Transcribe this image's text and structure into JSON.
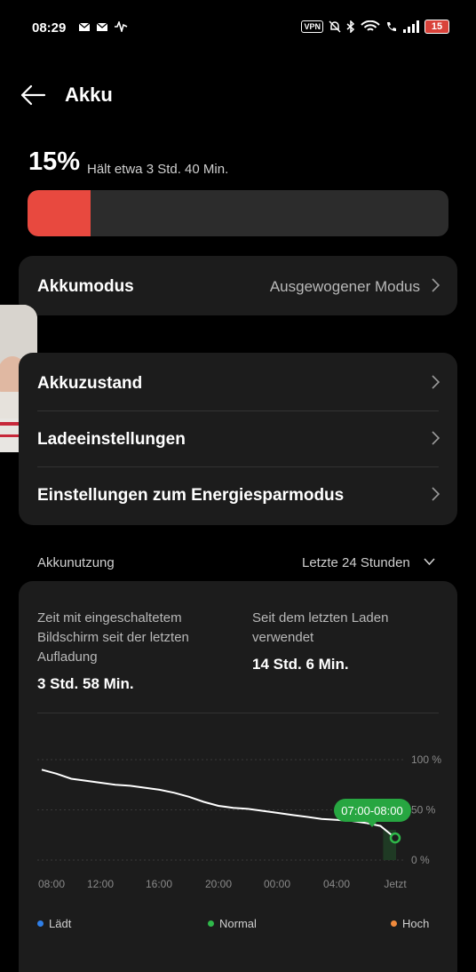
{
  "status_bar": {
    "time": "08:29",
    "vpn": "VPN",
    "battery": "15"
  },
  "header": {
    "title": "Akku"
  },
  "battery": {
    "percent_label": "15%",
    "percent_value": 15,
    "remaining": "Hält etwa 3 Std. 40 Min."
  },
  "mode_row": {
    "label": "Akkumodus",
    "value": "Ausgewogener Modus"
  },
  "settings": [
    {
      "label": "Akkuzustand"
    },
    {
      "label": "Ladeeinstellungen"
    },
    {
      "label": "Einstellungen zum Energiesparmodus"
    }
  ],
  "usage": {
    "section_label": "Akkunutzung",
    "range_label": "Letzte 24 Stunden",
    "screen_on_label": "Zeit mit eingeschaltetem Bildschirm seit der letzten Aufladung",
    "screen_on_label_lines": [
      "Zeit mit eingeschaltetem",
      "Bildschirm seit der letzten",
      "Aufladung"
    ],
    "screen_on_value": "3 Std. 58 Min.",
    "since_charge_label_lines": [
      "Seit dem letzten Laden",
      "verwendet"
    ],
    "since_charge_value": "14 Std. 6 Min."
  },
  "chart_data": {
    "type": "line",
    "x_ticks": [
      "08:00",
      "12:00",
      "16:00",
      "20:00",
      "00:00",
      "04:00",
      "Jetzt"
    ],
    "y_ticks": [
      "100 %",
      "50 %",
      "0 %"
    ],
    "ylim": [
      0,
      100
    ],
    "series": [
      {
        "x": [
          0,
          1,
          2,
          3,
          4,
          5,
          6,
          7,
          8,
          9,
          10,
          11,
          12,
          13,
          14,
          15,
          16,
          17,
          18,
          19,
          20,
          21,
          22,
          23,
          24
        ],
        "values": [
          90,
          86,
          81,
          79,
          77,
          75,
          74,
          72,
          70,
          67,
          63,
          58,
          54,
          52,
          51,
          49,
          47,
          45,
          43,
          41,
          40,
          39,
          37,
          34,
          22
        ],
        "color": "#ffffff"
      }
    ],
    "tooltip": "07:00-08:00",
    "legend": [
      {
        "label": "Lädt",
        "color": "#2f7fe8"
      },
      {
        "label": "Normal",
        "color": "#2fb84a"
      },
      {
        "label": "Hoch",
        "color": "#f08a3c"
      }
    ]
  }
}
